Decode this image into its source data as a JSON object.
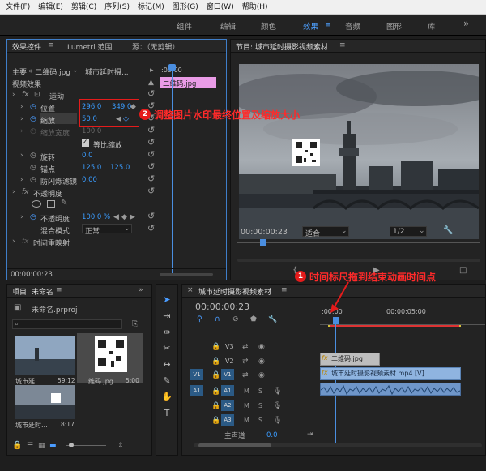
{
  "menubar": [
    "文件(F)",
    "编辑(E)",
    "剪辑(C)",
    "序列(S)",
    "标记(M)",
    "图形(G)",
    "窗口(W)",
    "帮助(H)"
  ],
  "workspaces": [
    "组件",
    "编辑",
    "颜色",
    "效果",
    "音频",
    "图形",
    "库"
  ],
  "workspace_active": "效果",
  "effect_controls": {
    "tab_label": "效果控件",
    "tab_lumetri": "Lumetri 范围",
    "tab_source": "源：（无剪辑）",
    "master": "主要 * 二维码.jpg",
    "clip": "城市延时摄...",
    "clip_timecode": ":00:00",
    "clip_label": "二维码.jpg",
    "video_effects": "视频效果",
    "motion": "运动",
    "position_label": "位置",
    "position_x": "296.0",
    "position_y": "349.0",
    "scale_label": "缩放",
    "scale_value": "50.0",
    "scale_width_label": "缩放宽度",
    "scale_width_value": "100.0",
    "uniform_scale": "等比缩放",
    "rotation_label": "旋转",
    "rotation_value": "0.0",
    "anchor_label": "锚点",
    "anchor_x": "125.0",
    "anchor_y": "125.0",
    "antiflicker_label": "防闪烁滤镜",
    "antiflicker_value": "0.00",
    "opacity": "不透明度",
    "opacity_label": "不透明度",
    "opacity_value": "100.0 %",
    "blend_label": "混合模式",
    "blend_value": "正常",
    "time_remap": "时间重映射",
    "footer_tc": "00:00:00:23"
  },
  "program": {
    "title": "节目: 城市延时摄影视频素材",
    "timecode": "00:00:00:23",
    "fit": "适合",
    "res": "1/2"
  },
  "project": {
    "title": "项目: 未命名",
    "file": "未命名.prproj",
    "items": [
      {
        "name": "城市延...",
        "dur": "59:12"
      },
      {
        "name": "二维码.jpg",
        "dur": "5:00"
      },
      {
        "name": "城市延时...",
        "dur": "8:17"
      }
    ]
  },
  "timeline": {
    "title": "城市延时摄影视频素材",
    "timecode": "00:00:00:23",
    "ruler_left": ":00:00",
    "ruler_mid": "00:00:05:00",
    "tracks_v": [
      "V3",
      "V2",
      "V1"
    ],
    "tracks_a": [
      "A1",
      "A2",
      "A3"
    ],
    "src_v": "V1",
    "src_a": "A1",
    "clip_v2": "二维码.jpg",
    "clip_v1": "城市延时摄影视频素材.mp4 [V]",
    "master_label": "主声道",
    "master_value": "0.0"
  },
  "annotations": {
    "step1_num": "1",
    "step1_text": "时间标尺拖到结束动画时间点",
    "step2_num": "2",
    "step2_text": "调整图片水印最终位置及缩放大小"
  }
}
